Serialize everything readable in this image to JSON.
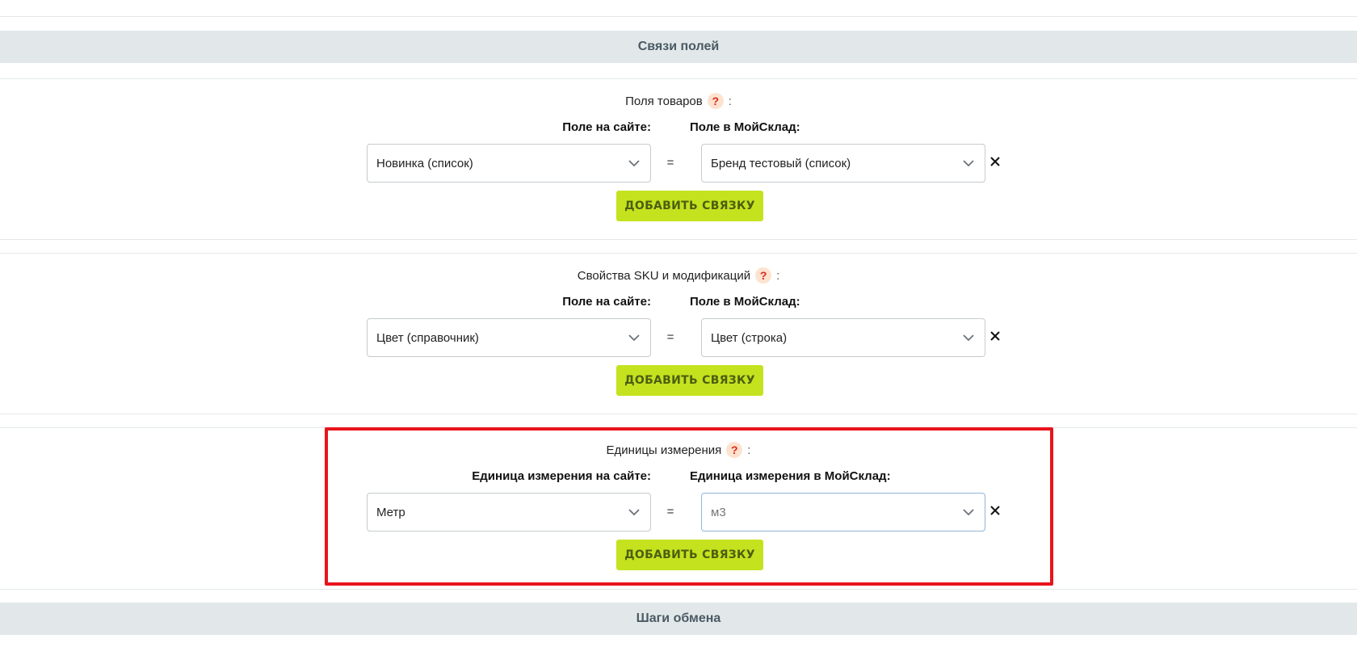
{
  "sections": {
    "field_links_header": "Связи полей",
    "exchange_steps_header": "Шаги обмена"
  },
  "blocks": [
    {
      "title": "Поля товаров",
      "help": "?",
      "colon": ":",
      "left_label": "Поле на сайте:",
      "right_label": "Поле в МойСклад:",
      "left_value": "Новинка (список)",
      "equals": "=",
      "right_value": "Бренд тестовый (список)",
      "add_label": "ДОБАВИТЬ СВЯЗКУ"
    },
    {
      "title": "Свойства SKU и модификаций",
      "help": "?",
      "colon": ":",
      "left_label": "Поле на сайте:",
      "right_label": "Поле в МойСклад:",
      "left_value": "Цвет (справочник)",
      "equals": "=",
      "right_value": "Цвет (строка)",
      "add_label": "ДОБАВИТЬ СВЯЗКУ"
    },
    {
      "title": "Единицы измерения",
      "help": "?",
      "colon": ":",
      "left_label": "Единица измерения на сайте:",
      "right_label": "Единица измерения в МойСклад:",
      "left_value": "Метр",
      "equals": "=",
      "right_value": "м3",
      "add_label": "ДОБАВИТЬ СВЯЗКУ"
    }
  ],
  "icons": {
    "chevron": "chevron-down-icon",
    "remove": "close-icon",
    "help": "question-icon"
  },
  "colors": {
    "accent_button": "#c5e21f",
    "highlight_border": "#e8141b",
    "help_badge_bg": "#fde3cf",
    "help_badge_fg": "#e0261b",
    "section_header_bg": "#e2e8ea"
  }
}
